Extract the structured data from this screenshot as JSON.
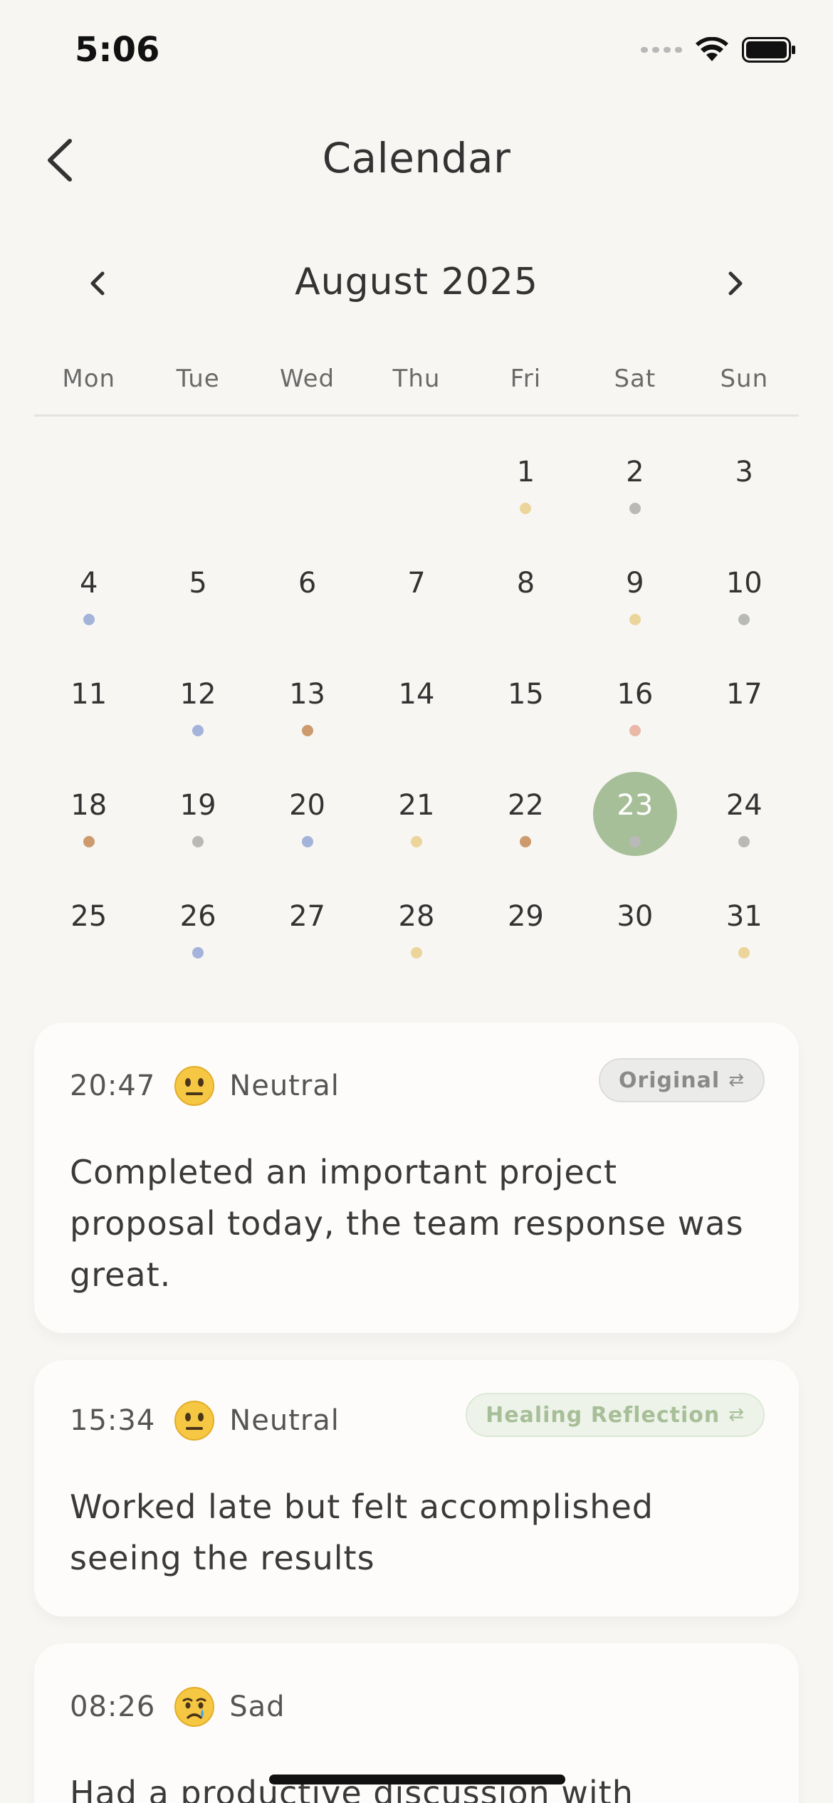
{
  "status_bar": {
    "time": "5:06"
  },
  "header": {
    "title": "Calendar"
  },
  "calendar": {
    "month_label": "August 2025",
    "weekdays": [
      "Mon",
      "Tue",
      "Wed",
      "Thu",
      "Fri",
      "Sat",
      "Sun"
    ],
    "leading_blanks": 4,
    "selected_day": 23,
    "mood_colors": {
      "yellow": "#ecd59a",
      "gray": "#b9b9b7",
      "blue": "#a3b3da",
      "brown": "#cc9a6c",
      "pink": "#eab8a6"
    },
    "days": [
      {
        "day": "1",
        "mood": "yellow"
      },
      {
        "day": "2",
        "mood": "gray"
      },
      {
        "day": "3",
        "mood": null
      },
      {
        "day": "4",
        "mood": "blue"
      },
      {
        "day": "5",
        "mood": null
      },
      {
        "day": "6",
        "mood": null
      },
      {
        "day": "7",
        "mood": null
      },
      {
        "day": "8",
        "mood": null
      },
      {
        "day": "9",
        "mood": "yellow"
      },
      {
        "day": "10",
        "mood": "gray"
      },
      {
        "day": "11",
        "mood": null
      },
      {
        "day": "12",
        "mood": "blue"
      },
      {
        "day": "13",
        "mood": "brown"
      },
      {
        "day": "14",
        "mood": null
      },
      {
        "day": "15",
        "mood": null
      },
      {
        "day": "16",
        "mood": "pink"
      },
      {
        "day": "17",
        "mood": null
      },
      {
        "day": "18",
        "mood": "brown"
      },
      {
        "day": "19",
        "mood": "gray"
      },
      {
        "day": "20",
        "mood": "blue"
      },
      {
        "day": "21",
        "mood": "yellow"
      },
      {
        "day": "22",
        "mood": "brown"
      },
      {
        "day": "23",
        "mood": "gray"
      },
      {
        "day": "24",
        "mood": "gray"
      },
      {
        "day": "25",
        "mood": null
      },
      {
        "day": "26",
        "mood": "blue"
      },
      {
        "day": "27",
        "mood": null
      },
      {
        "day": "28",
        "mood": "yellow"
      },
      {
        "day": "29",
        "mood": null
      },
      {
        "day": "30",
        "mood": null
      },
      {
        "day": "31",
        "mood": "yellow"
      }
    ]
  },
  "entries": [
    {
      "time": "20:47",
      "mood_icon": "neutral-face-icon",
      "mood": "Neutral",
      "badge": "Original",
      "text": "Completed an important project proposal today, the team response was great."
    },
    {
      "time": "15:34",
      "mood_icon": "neutral-face-icon",
      "mood": "Neutral",
      "badge": "Healing Reflection",
      "text": "Worked late but felt accomplished seeing the results"
    },
    {
      "time": "08:26",
      "mood_icon": "crying-face-icon",
      "mood": "Sad",
      "text": "Had a productive discussion with"
    }
  ],
  "badge_swap_glyph": "⇄"
}
